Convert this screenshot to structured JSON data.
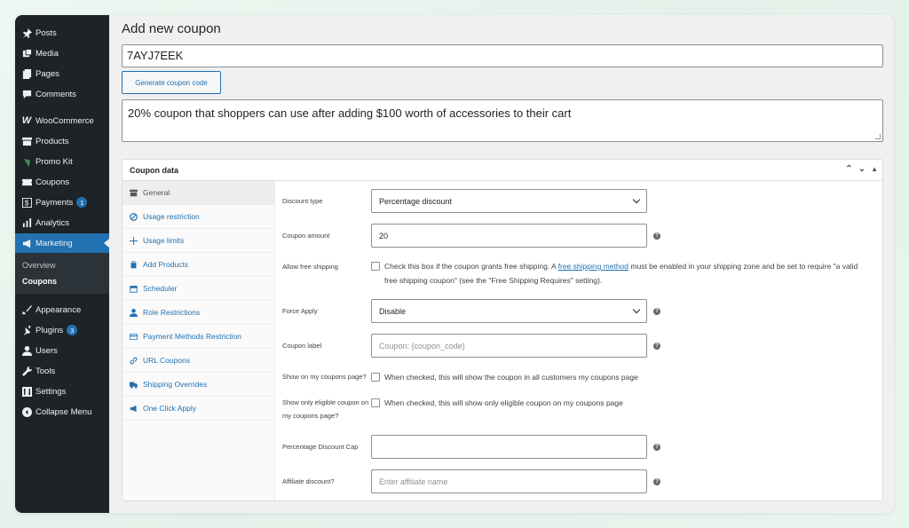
{
  "sidebar": {
    "items": [
      {
        "label": "Posts",
        "icon": "pin-icon"
      },
      {
        "label": "Media",
        "icon": "media-icon"
      },
      {
        "label": "Pages",
        "icon": "pages-icon"
      },
      {
        "label": "Comments",
        "icon": "comment-icon"
      },
      {
        "label": "WooCommerce",
        "icon": "woo-icon"
      },
      {
        "label": "Products",
        "icon": "archive-icon"
      },
      {
        "label": "Promo Kit",
        "icon": "promo-icon"
      },
      {
        "label": "Coupons",
        "icon": "ticket-icon"
      },
      {
        "label": "Payments",
        "icon": "dollar-icon",
        "badge": "1"
      },
      {
        "label": "Analytics",
        "icon": "bar-chart-icon"
      },
      {
        "label": "Marketing",
        "icon": "megaphone-icon",
        "active": true
      },
      {
        "label": "Appearance",
        "icon": "brush-icon"
      },
      {
        "label": "Plugins",
        "icon": "plug-icon",
        "badge": "3"
      },
      {
        "label": "Users",
        "icon": "user-icon"
      },
      {
        "label": "Tools",
        "icon": "wrench-icon"
      },
      {
        "label": "Settings",
        "icon": "settings-icon"
      },
      {
        "label": "Collapse Menu",
        "icon": "collapse-icon"
      }
    ],
    "submenu": {
      "overview": "Overview",
      "coupons": "Coupons"
    }
  },
  "header": {
    "title": "Add new coupon"
  },
  "coupon": {
    "code": "7AYJ7EEK",
    "generate_label": "Generate coupon code",
    "description": "20% coupon that shoppers can use after adding $100 worth of accessories to their cart"
  },
  "panel": {
    "title": "Coupon data",
    "tabs": [
      {
        "label": "General",
        "icon": "wrench-icon"
      },
      {
        "label": "Usage restriction",
        "icon": "ban-icon"
      },
      {
        "label": "Usage limits",
        "icon": "plus-icon"
      },
      {
        "label": "Add Products",
        "icon": "cart-icon"
      },
      {
        "label": "Scheduler",
        "icon": "calendar-icon"
      },
      {
        "label": "Role Restrictions",
        "icon": "user-icon"
      },
      {
        "label": "Payment Methods Restriction",
        "icon": "card-icon"
      },
      {
        "label": "URL Coupons",
        "icon": "link-icon"
      },
      {
        "label": "Shipping Overrides",
        "icon": "truck-icon"
      },
      {
        "label": "One Click Apply",
        "icon": "megaphone-icon"
      }
    ],
    "fields": {
      "discount_type": {
        "label": "Discount type",
        "value": "Percentage discount"
      },
      "coupon_amount": {
        "label": "Coupon amount",
        "value": "20"
      },
      "free_shipping": {
        "label": "Allow free shipping",
        "text_before": "Check this box if the coupon grants free shipping. A ",
        "link": "free shipping method",
        "text_after": " must be enabled in your shipping zone and be set to require \"a valid free shipping coupon\" (see the \"Free Shipping Requires\" setting)."
      },
      "force_apply": {
        "label": "Force Apply",
        "value": "Disable"
      },
      "coupon_label": {
        "label": "Coupon label",
        "placeholder": "Coupon: {coupon_code}"
      },
      "show_on_page": {
        "label": "Show on my coupons page?",
        "text": "When checked, this will show the coupon in all customers my coupons page"
      },
      "show_eligible": {
        "label": "Show only eligible coupon on my coupons page?",
        "text": "When checked, this will show only eligible coupon on my coupons page"
      },
      "discount_cap": {
        "label": "Percentage Discount Cap",
        "value": ""
      },
      "affiliate": {
        "label": "Affiliate discount?",
        "placeholder": "Enter affiliate name"
      }
    }
  },
  "colors": {
    "accent": "#2271b1",
    "sidebar": "#1d2327",
    "badge": "#2271b1"
  }
}
